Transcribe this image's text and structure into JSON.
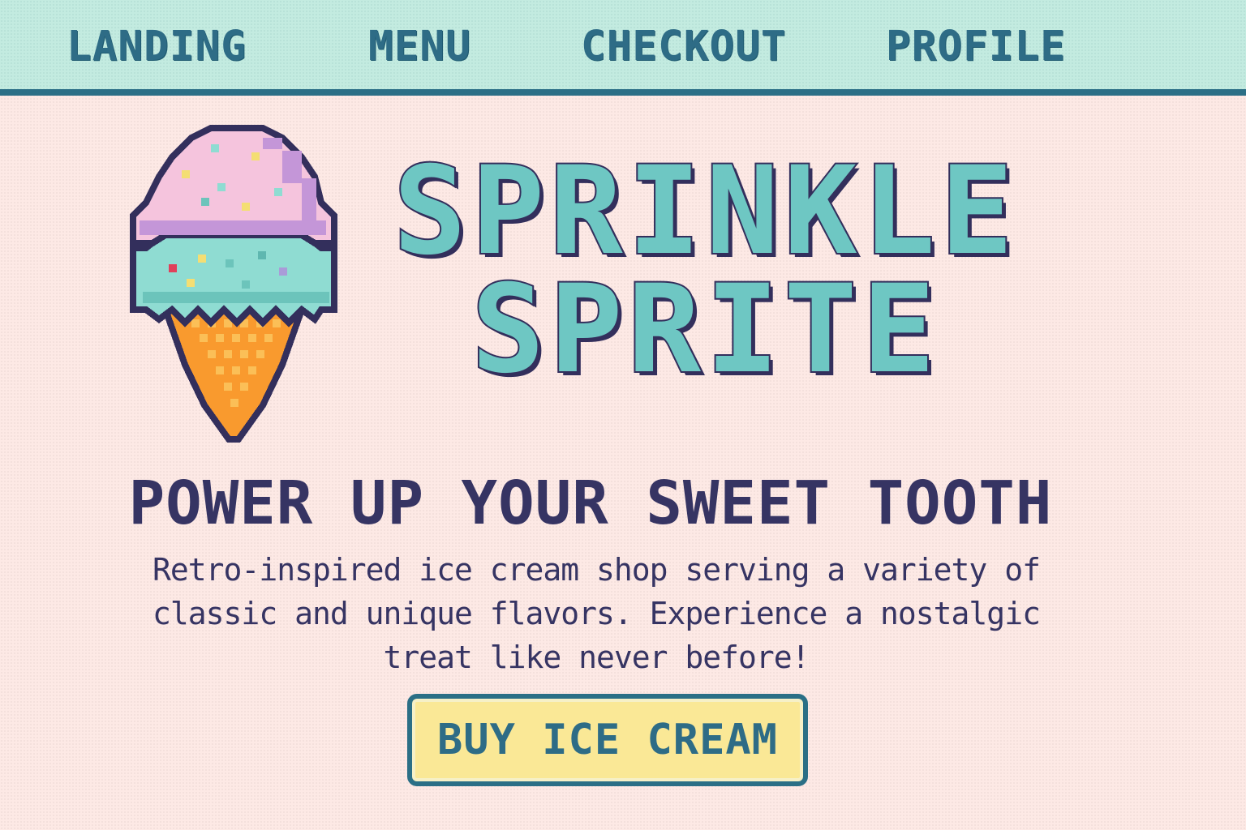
{
  "nav": {
    "items": [
      {
        "label": "LANDING"
      },
      {
        "label": "MENU"
      },
      {
        "label": "CHECKOUT"
      },
      {
        "label": "PROFILE"
      }
    ]
  },
  "hero": {
    "brand_line_1": "SPRINKLE",
    "brand_line_2": "SPRITE",
    "tagline": "POWER UP YOUR SWEET TOOTH",
    "description": "Retro-inspired ice cream shop serving a variety of classic and unique flavors. Experience a nostalgic treat like never before!",
    "cta_label": "BUY ICE CREAM",
    "illustration": "ice-cream-cone-icon"
  },
  "colors": {
    "nav_bg": "#c3ebe0",
    "nav_text": "#2e6c86",
    "page_bg": "#fde9e5",
    "title_fill": "#6ec7c3",
    "title_outline": "#332f5c",
    "text_dark": "#363463",
    "button_bg": "#fae896",
    "scoop_pink": "#f5c4dd",
    "scoop_mint": "#8fdcd2",
    "cone_orange": "#f99a2e"
  }
}
